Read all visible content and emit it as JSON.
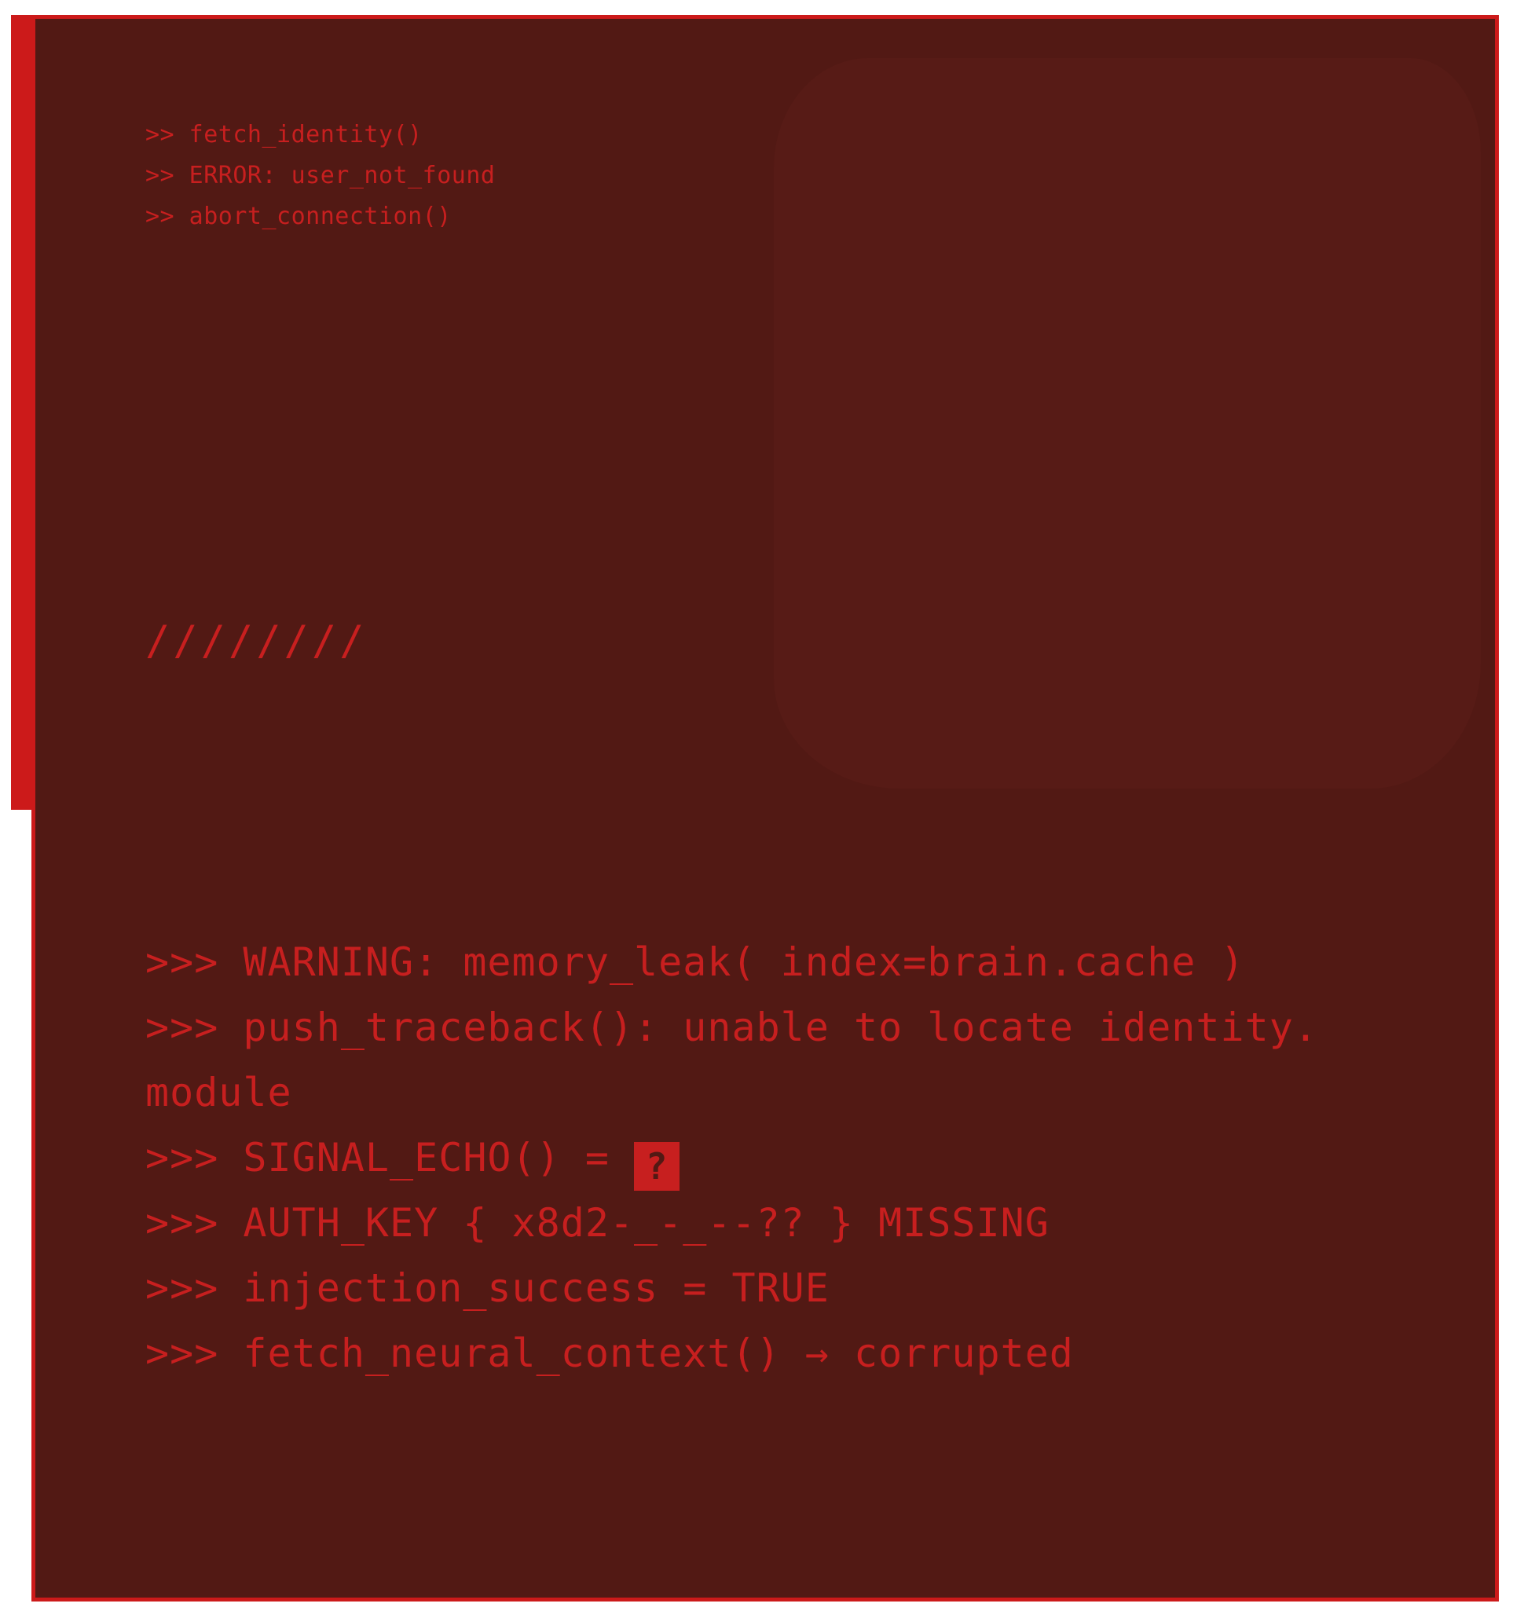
{
  "colors": {
    "accent": "#cc1a1a",
    "panel_bg": "#521914",
    "text": "#c71f1f"
  },
  "log_small": [
    ">> fetch_identity()",
    ">> ERROR: user_not_found",
    ">> abort_connection()"
  ],
  "divider_text": "////////",
  "log_large": {
    "line1": ">>> WARNING: memory_leak( index=brain.cache )",
    "line2": ">>> push_traceback(): unable to locate identity.",
    "line3": "module",
    "line4_prefix": ">>> SIGNAL_ECHO() = ",
    "line4_glyph": "?",
    "line4_glyph_icon": "question-block-icon",
    "line5": ">>> AUTH_KEY { x8d2-_-_--?? } MISSING",
    "line6": ">>> injection_success = TRUE",
    "line7": ">>> fetch_neural_context() → corrupted"
  }
}
